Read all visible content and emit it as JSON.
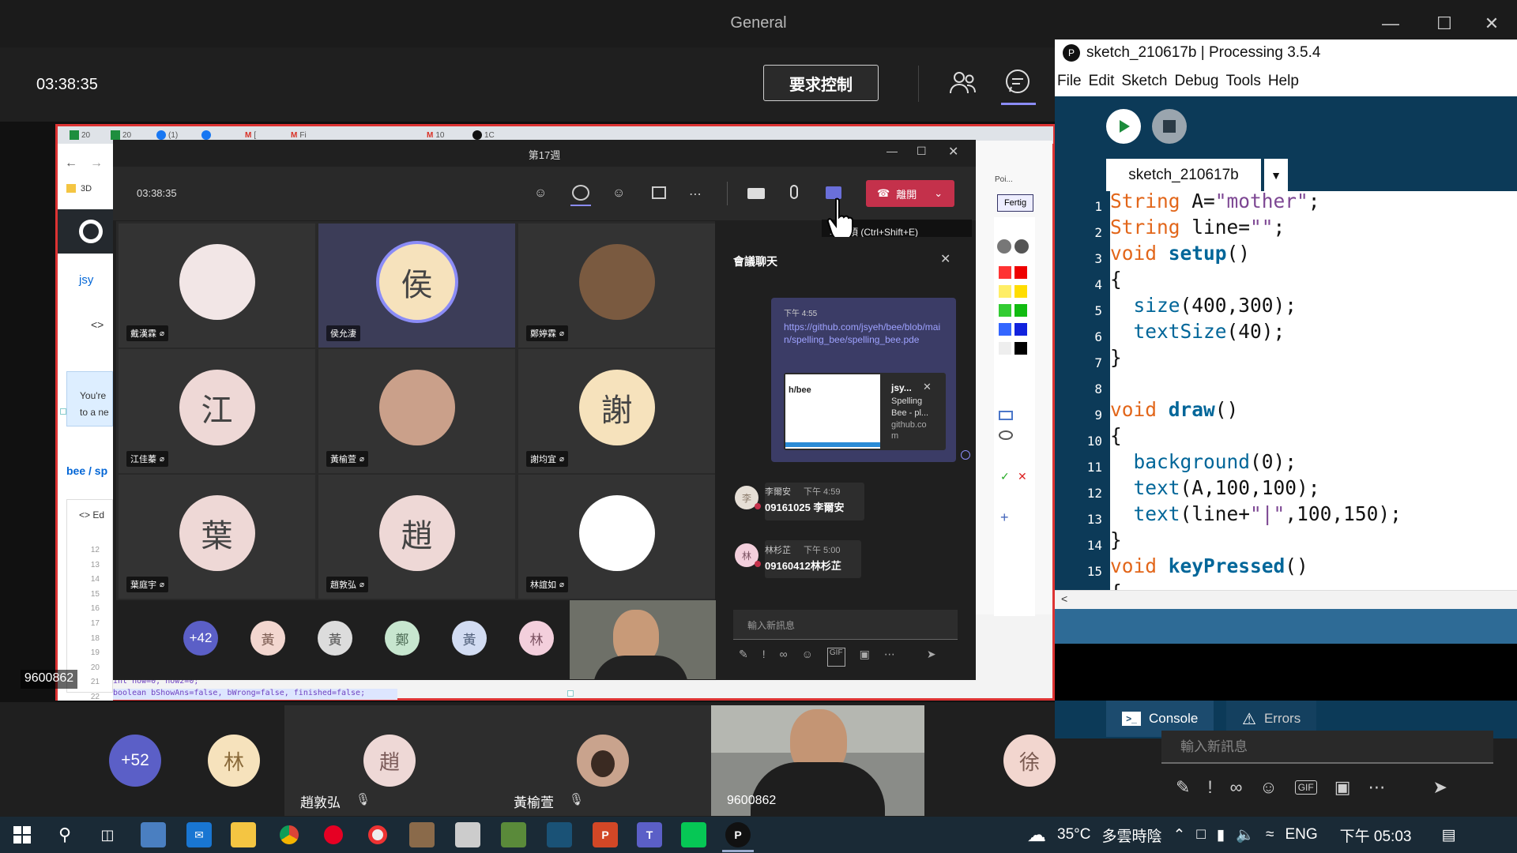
{
  "teams": {
    "window_title": "General",
    "timer": "03:38:35",
    "request_control": "要求控制",
    "overlay_id": "9600862"
  },
  "shared_screen": {
    "inner_title": "第17週",
    "inner_timer": "03:38:35",
    "leave_label": "離開",
    "tooltip": "享選項 (Ctrl+Shift+E)",
    "tiles": [
      {
        "name": "戴漢霖",
        "initial": "",
        "bg": "#f2e6e6"
      },
      {
        "name": "侯允淒",
        "initial": "侯",
        "bg": "#f6e2bc"
      },
      {
        "name": "鄭婷霖",
        "initial": "",
        "bg": "#7a5a40"
      },
      {
        "name": "江佳蓁",
        "initial": "江",
        "bg": "#eed8d6"
      },
      {
        "name": "黃榆萱",
        "initial": "",
        "bg": "#caa08a"
      },
      {
        "name": "謝均宜",
        "initial": "謝",
        "bg": "#f6e2bc"
      },
      {
        "name": "葉庭宇",
        "initial": "葉",
        "bg": "#eed8d6"
      },
      {
        "name": "趙敦弘",
        "initial": "趙",
        "bg": "#eed8d6"
      },
      {
        "name": "林誼如",
        "initial": "",
        "bg": "#ffffff"
      }
    ],
    "bottom_avatars": [
      {
        "label": "+42",
        "bg": "#5b5fc7",
        "fg": "#ffffff"
      },
      {
        "label": "黃",
        "bg": "#f2d6cf",
        "fg": "#7a5a50"
      },
      {
        "label": "黃",
        "bg": "#dcdcdc",
        "fg": "#555555"
      },
      {
        "label": "鄭",
        "bg": "#c7e6cf",
        "fg": "#4d6b55"
      },
      {
        "label": "黃",
        "bg": "#d2dcf2",
        "fg": "#51607a"
      },
      {
        "label": "林",
        "bg": "#f3cfdc",
        "fg": "#7a5060"
      }
    ],
    "chat": {
      "title": "會議聊天",
      "msg_time": "下午 4:55",
      "link": "https://github.com/jsyeh/bee/blob/main/spelling_bee/spelling_bee.pde",
      "card_path": "h/bee",
      "card_title": "jsy...",
      "card_sub1": "Spelling",
      "card_sub2": "Bee - pl...",
      "card_host": "github.co",
      "card_host2": "m",
      "msg2_name": "李爾安",
      "msg2_time": "下午 4:59",
      "msg2_text": "09161025 李爾安",
      "msg2_avatar": "李",
      "msg3_name": "林杉芷",
      "msg3_time": "下午 5:00",
      "msg3_text": "09160412林杉芷",
      "msg3_avatar": "林",
      "compose_placeholder": "輸入新訊息"
    },
    "browser": {
      "tab_labels": [
        "20",
        "20",
        "(1)",
        "Fi",
        "[",
        "10",
        "1C"
      ],
      "left_3d": "3D",
      "left_js": "jsy",
      "left_youre": "You're",
      "left_tone": "to a ne",
      "left_bee": "bee / sp",
      "left_ed": "Ed",
      "line_nums": [
        "12",
        "13",
        "14",
        "15",
        "16",
        "17",
        "18",
        "19",
        "20",
        "21",
        "22"
      ],
      "code_a": "int now=0, now2=0;",
      "code_b": "boolean bShowAns=false, bWrong=false, finished=false;",
      "fertig": "Fertig",
      "poi": "Poi..."
    }
  },
  "strip": {
    "count": "+52",
    "avatar1": "林",
    "tile1_name": "趙敦弘",
    "tile1_initial": "趙",
    "tile2_name": "黃榆萱",
    "cam_id": "9600862",
    "avatar_right": "徐"
  },
  "processing": {
    "title": "sketch_210617b | Processing 3.5.4",
    "menu": [
      "File",
      "Edit",
      "Sketch",
      "Debug",
      "Tools",
      "Help"
    ],
    "tab": "sketch_210617b",
    "console_tab": "Console",
    "errors_tab": "Errors",
    "line_numbers": [
      "1",
      "2",
      "3",
      "4",
      "5",
      "6",
      "7",
      "8",
      "9",
      "10",
      "11",
      "12",
      "13",
      "14",
      "15"
    ]
  },
  "teams_compose_placeholder": "輸入新訊息",
  "taskbar": {
    "temp": "35°C",
    "weather": "多雲時陰",
    "lang": "ENG",
    "time": "下午 05:03"
  },
  "colors": {
    "teams_purple": "#5b5fc7",
    "leave_red": "#c4314b",
    "processing_blue": "#0c3a58",
    "share_border": "#dd3333"
  }
}
